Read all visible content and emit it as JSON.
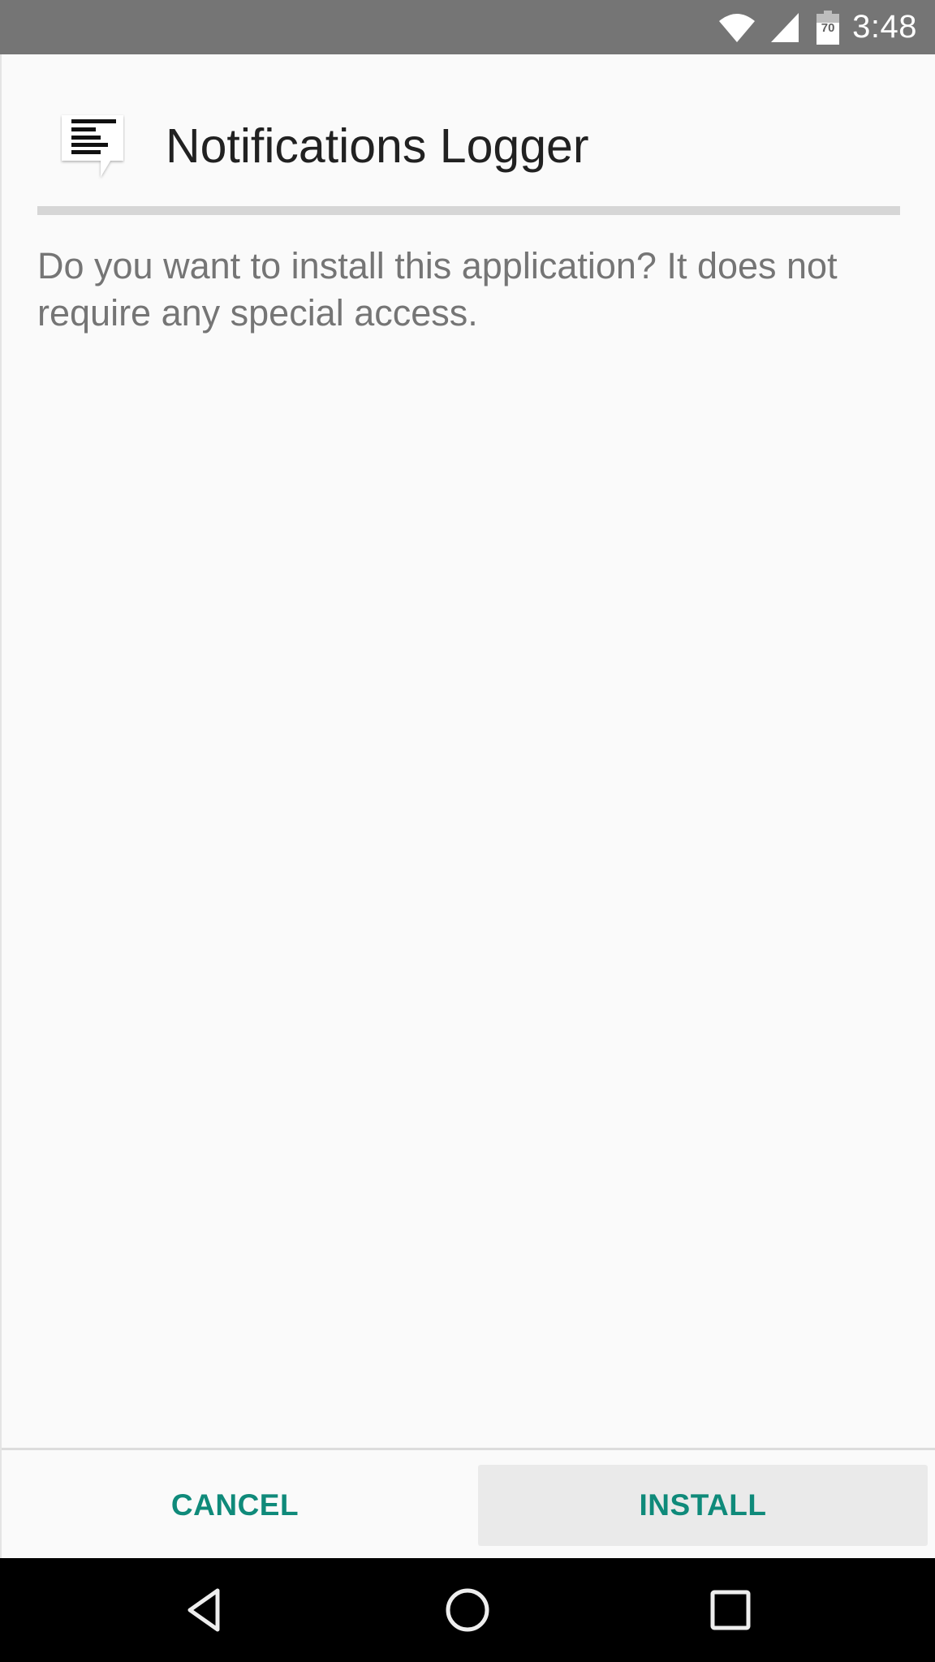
{
  "status_bar": {
    "time": "3:48",
    "battery_level": "70",
    "icons": [
      "wifi-icon",
      "cellular-signal-icon",
      "battery-icon"
    ]
  },
  "dialog": {
    "app_name": "Notifications Logger",
    "app_icon": "notes-speech-bubble-icon",
    "message": "Do you want to install this application? It does not require any special access.",
    "cancel_label": "CANCEL",
    "install_label": "INSTALL",
    "accent_color": "#0f8a7a"
  },
  "nav_bar": {
    "buttons": [
      "back-icon",
      "home-icon",
      "recents-icon"
    ]
  }
}
